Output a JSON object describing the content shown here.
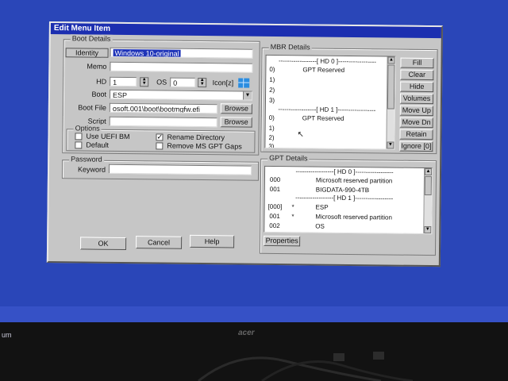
{
  "window": {
    "title": "Edit Menu Item"
  },
  "boot_details": {
    "legend": "Boot Details",
    "identity_label": "Identity",
    "identity_value": "Windows 10-original",
    "memo_label": "Memo",
    "memo_value": "",
    "hd_label": "HD",
    "hd_value": "1",
    "os_label": "OS",
    "os_value": "0",
    "icon_label": "Icon[z]",
    "boot_label": "Boot",
    "boot_value": "ESP",
    "bootfile_label": "Boot File",
    "bootfile_value": "osoft.001\\boot\\bootmgfw.efi",
    "browse_label": "Browse",
    "script_label": "Script",
    "script_value": "",
    "browse2_label": "Browse",
    "options_legend": "Options",
    "use_uefi_label": "Use UEFI BM",
    "default_label": "Default",
    "rename_dir_label": "Rename Directory",
    "remove_gpt_label": "Remove MS GPT Gaps"
  },
  "password": {
    "legend": "Password",
    "keyword_label": "Keyword",
    "keyword_value": ""
  },
  "buttons": {
    "ok": "OK",
    "cancel": "Cancel",
    "help": "Help"
  },
  "mbr": {
    "legend": "MBR Details",
    "hd0_header": "------------------[ HD 0 ]------------------",
    "hd0_rows": [
      {
        "num": "0)",
        "name": "GPT Reserved"
      },
      {
        "num": "1)",
        "name": ""
      },
      {
        "num": "2)",
        "name": ""
      },
      {
        "num": "3)",
        "name": ""
      }
    ],
    "hd1_header": "------------------[ HD 1 ]------------------",
    "hd1_rows": [
      {
        "num": "0)",
        "name": "GPT Reserved"
      },
      {
        "num": "1)",
        "name": ""
      },
      {
        "num": "2)",
        "name": ""
      },
      {
        "num": "3)",
        "name": ""
      }
    ],
    "side_buttons": [
      "Fill",
      "Clear",
      "Hide",
      "Volumes",
      "Move Up",
      "Move Dn",
      "Retain",
      "Ignore [0]"
    ]
  },
  "gpt": {
    "legend": "GPT Details",
    "hd0_header": "------------------[ HD 0 ]------------------",
    "hd0_rows": [
      {
        "id": "000",
        "mark": "",
        "name": "Microsoft reserved partition"
      },
      {
        "id": "001",
        "mark": "",
        "name": "BIGDATA-990-4TB"
      }
    ],
    "hd1_header": "------------------[ HD 1 ]------------------",
    "hd1_rows": [
      {
        "id": "[000]",
        "mark": "*",
        "name": "ESP"
      },
      {
        "id": "001",
        "mark": "*",
        "name": "Microsoft reserved partition"
      },
      {
        "id": "002",
        "mark": "",
        "name": "OS"
      }
    ],
    "properties_label": "Properties"
  },
  "taskbar": {
    "fragment": "um"
  },
  "monitor": {
    "brand": "acer"
  },
  "colors": {
    "desktop": "#2a46b8",
    "titlebar": "#1c2fb0",
    "dialog": "#c6c6c6",
    "selection": "#1f34b8"
  }
}
